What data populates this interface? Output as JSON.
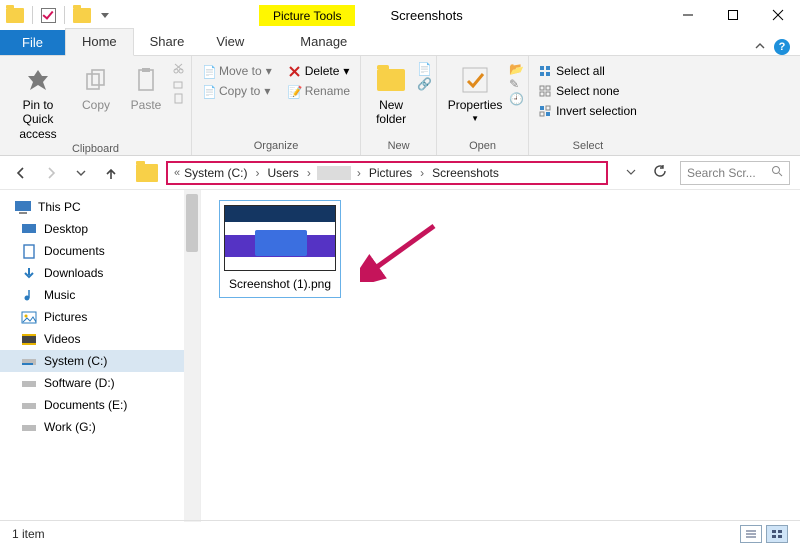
{
  "titlebar": {
    "contextual_tab": "Picture Tools",
    "window_title": "Screenshots"
  },
  "tabs": {
    "file": "File",
    "home": "Home",
    "share": "Share",
    "view": "View",
    "manage": "Manage"
  },
  "ribbon": {
    "clipboard": {
      "pin": "Pin to Quick access",
      "copy": "Copy",
      "paste": "Paste",
      "group_label": "Clipboard"
    },
    "organize": {
      "move_to": "Move to",
      "copy_to": "Copy to",
      "delete": "Delete",
      "rename": "Rename",
      "group_label": "Organize"
    },
    "new": {
      "new_folder": "New folder",
      "group_label": "New"
    },
    "open": {
      "properties": "Properties",
      "group_label": "Open"
    },
    "select": {
      "select_all": "Select all",
      "select_none": "Select none",
      "invert": "Invert selection",
      "group_label": "Select"
    }
  },
  "breadcrumb": {
    "seg1": "System (C:)",
    "seg2": "Users",
    "seg4": "Pictures",
    "seg5": "Screenshots"
  },
  "search": {
    "placeholder": "Search Scr..."
  },
  "tree": {
    "this_pc": "This PC",
    "desktop": "Desktop",
    "documents": "Documents",
    "downloads": "Downloads",
    "music": "Music",
    "pictures": "Pictures",
    "videos": "Videos",
    "drive_c": "System (C:)",
    "drive_d": "Software (D:)",
    "drive_e": "Documents (E:)",
    "drive_g": "Work (G:)"
  },
  "file": {
    "name": "Screenshot (1).png"
  },
  "status": {
    "count": "1 item"
  }
}
